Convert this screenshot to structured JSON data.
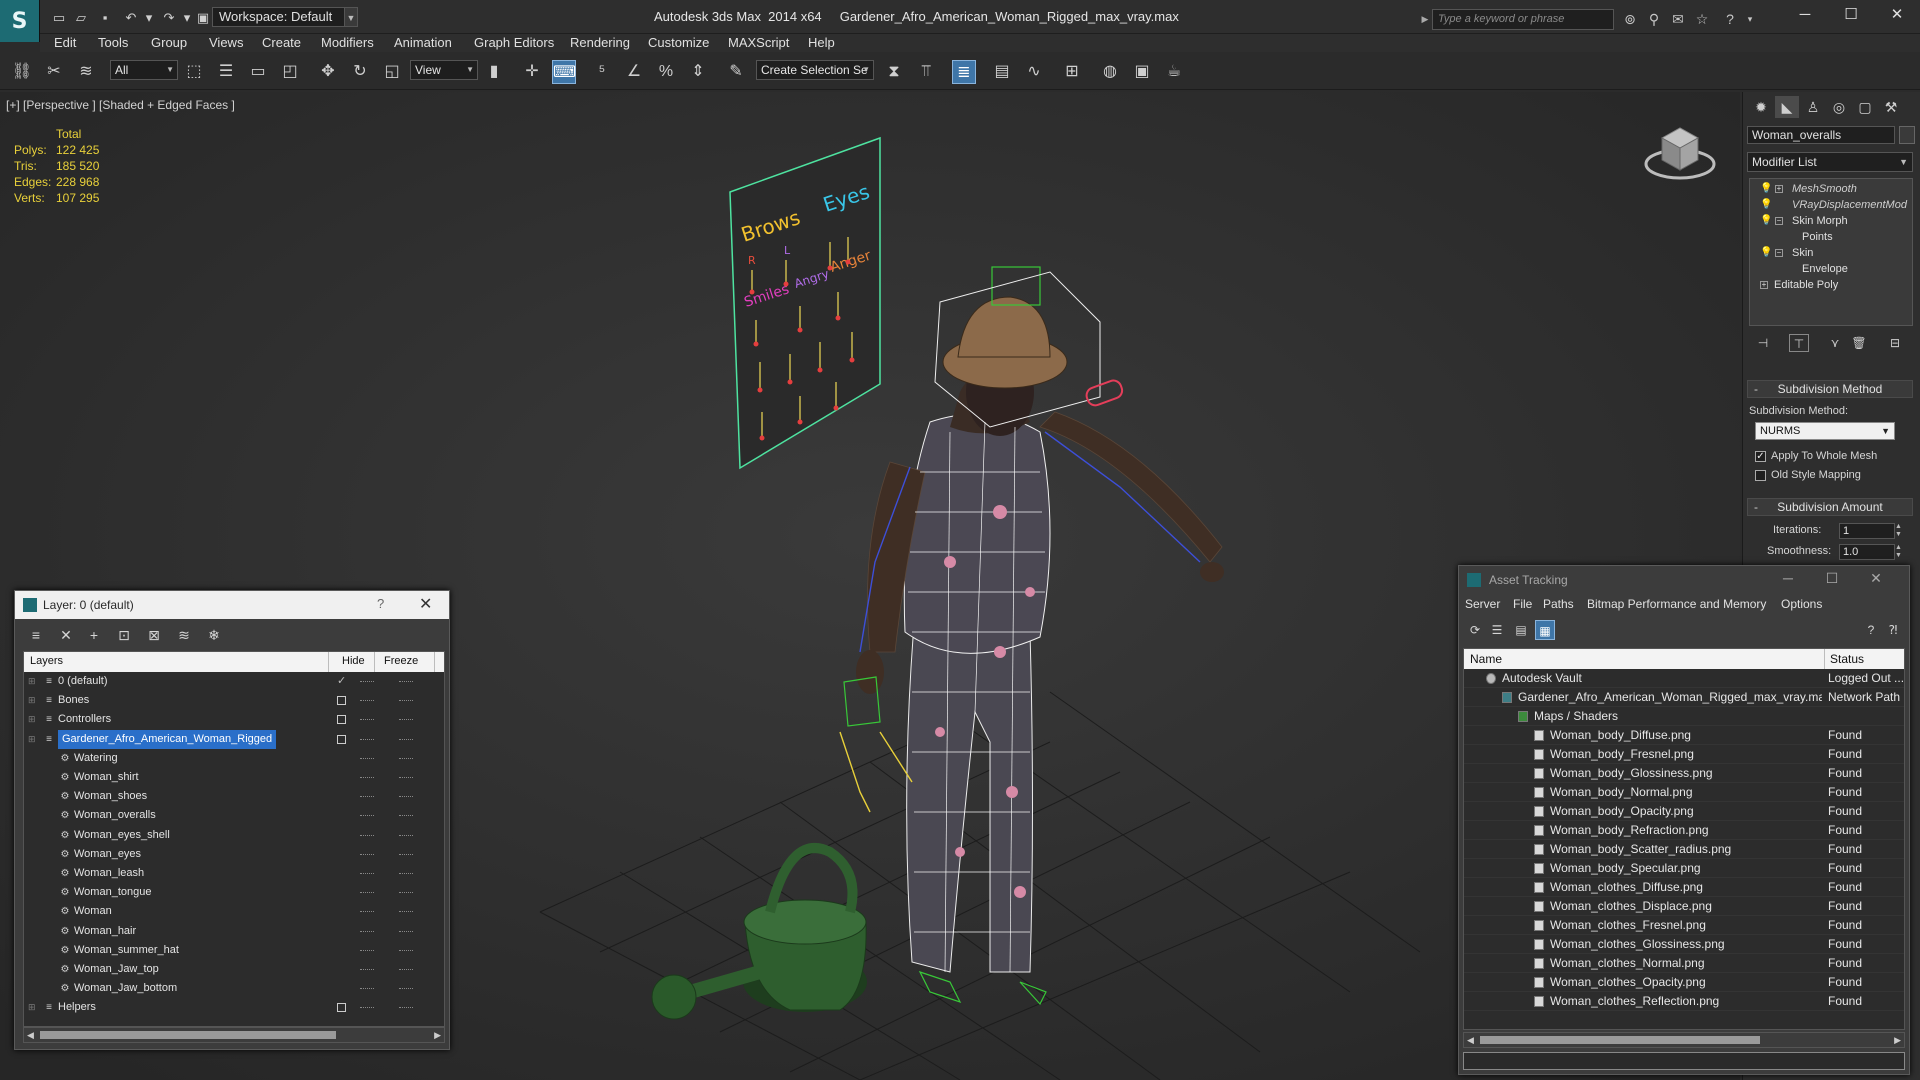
{
  "app": {
    "workspace_label": "Workspace: Default",
    "window_title": "Autodesk 3ds Max  2014 x64     Gardener_Afro_American_Woman_Rigged_max_vray.max",
    "search_placeholder": "Type a keyword or phrase"
  },
  "menu": [
    "Edit",
    "Tools",
    "Group",
    "Views",
    "Create",
    "Modifiers",
    "Animation",
    "Graph Editors",
    "Rendering",
    "Customize",
    "MAXScript",
    "Help"
  ],
  "toolbar": {
    "filter_value": "All",
    "coord_value": "View",
    "selection_set_placeholder": "Create Selection Se"
  },
  "viewport": {
    "label": "[+] [Perspective ] [Shaded + Edged Faces ]",
    "stats_header": "Total",
    "stats": [
      {
        "key": "Polys:",
        "value": "122 425"
      },
      {
        "key": "Tris:",
        "value": "185 520"
      },
      {
        "key": "Edges:",
        "value": "228 968"
      },
      {
        "key": "Verts:",
        "value": "107 295"
      }
    ],
    "panel_text": {
      "brows": "Brows",
      "eyes": "Eyes",
      "r": "R",
      "l": "L",
      "smiles": "Smiles",
      "angry": "Angry",
      "anger": "Anger"
    }
  },
  "command_panel": {
    "object_name": "Woman_overalls",
    "modifier_list": "Modifier List",
    "stack": [
      {
        "label": "MeshSmooth",
        "style": "italic",
        "bulb": true,
        "expander": "+"
      },
      {
        "label": "VRayDisplacementMod",
        "style": "italic",
        "bulb": true,
        "expander": ""
      },
      {
        "label": "Skin Morph",
        "style": "normal",
        "bulb": true,
        "expander": "−"
      },
      {
        "label": "Points",
        "style": "sub",
        "bulb": false,
        "expander": ""
      },
      {
        "label": "Skin",
        "style": "normal",
        "bulb": true,
        "expander": "−"
      },
      {
        "label": "Envelope",
        "style": "sub",
        "bulb": false,
        "expander": ""
      },
      {
        "label": "Editable Poly",
        "style": "normal",
        "bulb": false,
        "expander": "+"
      }
    ],
    "subdivision_method_title": "Subdivision Method",
    "subdivision_method_label": "Subdivision Method:",
    "subdivision_method_value": "NURMS",
    "apply_whole_mesh": "Apply To Whole Mesh",
    "old_style_mapping": "Old Style Mapping",
    "subdivision_amount_title": "Subdivision Amount",
    "iterations_label": "Iterations:",
    "iterations_value": "1",
    "smoothness_label": "Smoothness:",
    "smoothness_value": "1.0"
  },
  "layer_dialog": {
    "title": "Layer: 0 (default)",
    "help": "?",
    "col_layers": "Layers",
    "col_hide": "Hide",
    "col_freeze": "Freeze",
    "rows": [
      {
        "name": "0 (default)",
        "level": 0,
        "hide": "check",
        "selected": false
      },
      {
        "name": "Bones",
        "level": 0,
        "hide": "box",
        "selected": false
      },
      {
        "name": "Controllers",
        "level": 0,
        "hide": "box",
        "selected": false
      },
      {
        "name": "Gardener_Afro_American_Woman_Rigged",
        "level": 0,
        "hide": "box",
        "selected": true
      },
      {
        "name": "Watering",
        "level": 1,
        "hide": "",
        "selected": false
      },
      {
        "name": "Woman_shirt",
        "level": 1,
        "hide": "",
        "selected": false
      },
      {
        "name": "Woman_shoes",
        "level": 1,
        "hide": "",
        "selected": false
      },
      {
        "name": "Woman_overalls",
        "level": 1,
        "hide": "",
        "selected": false
      },
      {
        "name": "Woman_eyes_shell",
        "level": 1,
        "hide": "",
        "selected": false
      },
      {
        "name": "Woman_eyes",
        "level": 1,
        "hide": "",
        "selected": false
      },
      {
        "name": "Woman_leash",
        "level": 1,
        "hide": "",
        "selected": false
      },
      {
        "name": "Woman_tongue",
        "level": 1,
        "hide": "",
        "selected": false
      },
      {
        "name": "Woman",
        "level": 1,
        "hide": "",
        "selected": false
      },
      {
        "name": "Woman_hair",
        "level": 1,
        "hide": "",
        "selected": false
      },
      {
        "name": "Woman_summer_hat",
        "level": 1,
        "hide": "",
        "selected": false
      },
      {
        "name": "Woman_Jaw_top",
        "level": 1,
        "hide": "",
        "selected": false
      },
      {
        "name": "Woman_Jaw_bottom",
        "level": 1,
        "hide": "",
        "selected": false
      },
      {
        "name": "Helpers",
        "level": 0,
        "hide": "box",
        "selected": false
      }
    ]
  },
  "asset_dialog": {
    "title": "Asset Tracking",
    "menu": [
      "Server",
      "File",
      "Paths",
      "Bitmap Performance and Memory",
      "Options"
    ],
    "col_name": "Name",
    "col_status": "Status",
    "rows": [
      {
        "name": "Autodesk Vault",
        "status": "Logged Out ...",
        "indent": 0,
        "kind": "vault"
      },
      {
        "name": "Gardener_Afro_American_Woman_Rigged_max_vray.max",
        "status": "Network Path",
        "indent": 1,
        "kind": "max"
      },
      {
        "name": "Maps / Shaders",
        "status": "",
        "indent": 2,
        "kind": "folder"
      },
      {
        "name": "Woman_body_Diffuse.png",
        "status": "Found",
        "indent": 3,
        "kind": "file"
      },
      {
        "name": "Woman_body_Fresnel.png",
        "status": "Found",
        "indent": 3,
        "kind": "file"
      },
      {
        "name": "Woman_body_Glossiness.png",
        "status": "Found",
        "indent": 3,
        "kind": "file"
      },
      {
        "name": "Woman_body_Normal.png",
        "status": "Found",
        "indent": 3,
        "kind": "file"
      },
      {
        "name": "Woman_body_Opacity.png",
        "status": "Found",
        "indent": 3,
        "kind": "file"
      },
      {
        "name": "Woman_body_Refraction.png",
        "status": "Found",
        "indent": 3,
        "kind": "file"
      },
      {
        "name": "Woman_body_Scatter_radius.png",
        "status": "Found",
        "indent": 3,
        "kind": "file"
      },
      {
        "name": "Woman_body_Specular.png",
        "status": "Found",
        "indent": 3,
        "kind": "file"
      },
      {
        "name": "Woman_clothes_Diffuse.png",
        "status": "Found",
        "indent": 3,
        "kind": "file"
      },
      {
        "name": "Woman_clothes_Displace.png",
        "status": "Found",
        "indent": 3,
        "kind": "file"
      },
      {
        "name": "Woman_clothes_Fresnel.png",
        "status": "Found",
        "indent": 3,
        "kind": "file"
      },
      {
        "name": "Woman_clothes_Glossiness.png",
        "status": "Found",
        "indent": 3,
        "kind": "file"
      },
      {
        "name": "Woman_clothes_Normal.png",
        "status": "Found",
        "indent": 3,
        "kind": "file"
      },
      {
        "name": "Woman_clothes_Opacity.png",
        "status": "Found",
        "indent": 3,
        "kind": "file"
      },
      {
        "name": "Woman_clothes_Reflection.png",
        "status": "Found",
        "indent": 3,
        "kind": "file"
      }
    ]
  }
}
